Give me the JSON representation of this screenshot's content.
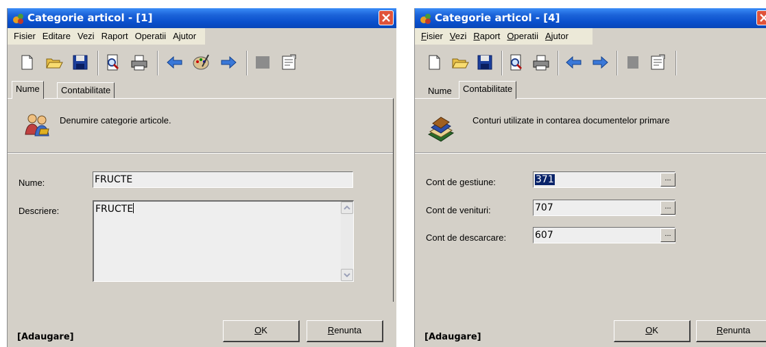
{
  "windows": [
    {
      "title": "Categorie articol - [1]",
      "menu": [
        "Fisier",
        "Editare",
        "Vezi",
        "Raport",
        "Operatii",
        "Ajutor"
      ],
      "tabs": [
        "Nume",
        "Contabilitate"
      ],
      "active_tab": "Nume",
      "header_text": "Denumire categorie articole.",
      "fields": {
        "nume_label": "Nume:",
        "nume_value": "FRUCTE",
        "descriere_label": "Descriere:",
        "descriere_value": "FRUCTE"
      },
      "status": "[Adaugare]",
      "ok_label": "OK",
      "cancel_label": "Renunta"
    },
    {
      "title": "Categorie articol - [4]",
      "menu": [
        "Fisier",
        "Vezi",
        "Raport",
        "Operatii",
        "Ajutor"
      ],
      "tabs": [
        "Nume",
        "Contabilitate"
      ],
      "active_tab": "Contabilitate",
      "header_text": "Conturi utilizate in contarea documentelor primare",
      "fields": {
        "gestiune_label": "Cont de gestiune:",
        "gestiune_value": "371",
        "venituri_label": "Cont de venituri:",
        "venituri_value": "707",
        "descarcare_label": "Cont de descarcare:",
        "descarcare_value": "607",
        "browse_label": "..."
      },
      "status": "[Adaugare]",
      "ok_label": "OK",
      "cancel_label": "Renunta"
    }
  ],
  "icons": [
    "app-icon",
    "close-icon",
    "new-document-icon",
    "open-folder-icon",
    "save-icon",
    "print-preview-icon",
    "print-icon",
    "arrow-left-icon",
    "palette-icon",
    "arrow-right-icon",
    "delete-icon",
    "properties-icon",
    "users-icon",
    "books-icon"
  ],
  "colors": {
    "titlebar": "#0a50cc",
    "window_face": "#d4d0c8",
    "close_button": "#e0533a",
    "selection": "#0a246a"
  }
}
